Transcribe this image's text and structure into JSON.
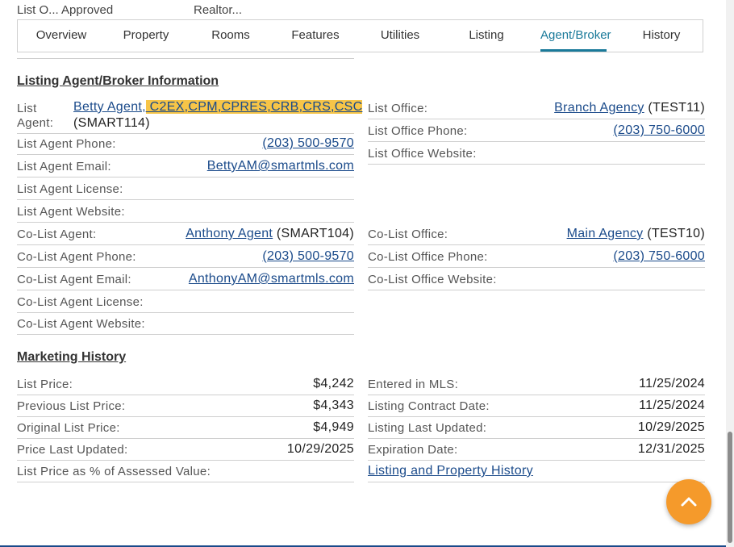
{
  "tabs": [
    {
      "label": "Overview",
      "active": false
    },
    {
      "label": "Property",
      "active": false
    },
    {
      "label": "Rooms",
      "active": false
    },
    {
      "label": "Features",
      "active": false
    },
    {
      "label": "Utilities",
      "active": false
    },
    {
      "label": "Listing",
      "active": false
    },
    {
      "label": "Agent/Broker",
      "active": true
    },
    {
      "label": "History",
      "active": false
    }
  ],
  "clipped_above": {
    "left_text": "List O... Approved",
    "right_text": "Realtor..."
  },
  "agent_section": {
    "title": "Listing Agent/Broker Information",
    "list_agent": {
      "label_line1": "List",
      "label_line2": "Agent:",
      "name_link": "Betty Agent,",
      "designations": " C2EX,CPM,CPRES,CRB,CRS,CSC",
      "id": "(SMART114)"
    },
    "left_rows": [
      {
        "label": "List Agent Phone:",
        "value": "(203) 500-9570",
        "link": true
      },
      {
        "label": "List Agent Email:",
        "value": "BettyAM@smartmls.com",
        "link": true
      },
      {
        "label": "List Agent License:",
        "value": ""
      },
      {
        "label": "List Agent Website:",
        "value": ""
      }
    ],
    "co_agent": {
      "label": "Co-List Agent:",
      "name_link": "Anthony Agent",
      "id": " (SMART104)"
    },
    "co_rows": [
      {
        "label": "Co-List Agent Phone:",
        "value": "(203) 500-9570",
        "link": true
      },
      {
        "label": "Co-List Agent Email:",
        "value": "AnthonyAM@smartmls.com",
        "link": true
      },
      {
        "label": "Co-List Agent License:",
        "value": ""
      },
      {
        "label": "Co-List Agent Website:",
        "value": ""
      }
    ],
    "list_office": {
      "label": "List Office:",
      "name_link": "Branch Agency",
      "id": " (TEST11)"
    },
    "right_rows": [
      {
        "label": "List Office Phone:",
        "value": "(203) 750-6000",
        "link": true
      },
      {
        "label": "List Office Website:",
        "value": ""
      }
    ],
    "co_office": {
      "label": "Co-List Office:",
      "name_link": "Main Agency",
      "id": " (TEST10)"
    },
    "co_right_rows": [
      {
        "label": "Co-List Office Phone:",
        "value": "(203) 750-6000",
        "link": true
      },
      {
        "label": "Co-List Office Website:",
        "value": ""
      }
    ]
  },
  "marketing_section": {
    "title": "Marketing History",
    "left_rows": [
      {
        "label": "List Price:",
        "value": "$4,242"
      },
      {
        "label": "Previous List Price:",
        "value": "$4,343"
      },
      {
        "label": "Original List Price:",
        "value": "$4,949"
      },
      {
        "label": "Price Last Updated:",
        "value": "10/29/2025"
      },
      {
        "label": "List Price as % of Assessed Value:",
        "value": ""
      }
    ],
    "right_rows": [
      {
        "label": "Entered in MLS:",
        "value": "11/25/2024"
      },
      {
        "label": "Listing Contract Date:",
        "value": "11/25/2024"
      },
      {
        "label": "Listing Last Updated:",
        "value": "10/29/2025"
      },
      {
        "label": "Expiration Date:",
        "value": "12/31/2025"
      }
    ],
    "history_link": "Listing and Property History"
  },
  "fab_icon": "chevron-up-icon",
  "colors": {
    "accent": "#1a7a9a",
    "link": "#1a4a8a",
    "highlight": "#f7c548",
    "fab": "#f59a2b"
  }
}
